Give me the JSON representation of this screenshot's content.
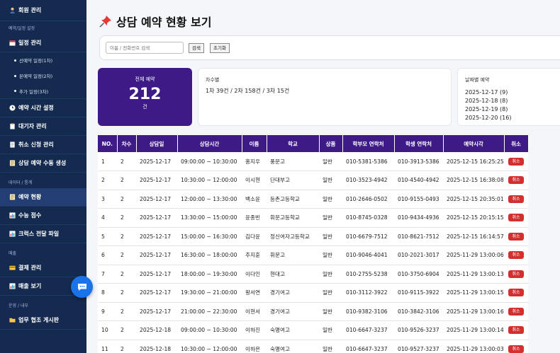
{
  "sidebar": {
    "member": "회원 관리",
    "section1": "예약/일정 설정",
    "schedule": "일정 관리",
    "sub1": "선예약 일정(1차)",
    "sub2": "본예약 일정(2차)",
    "sub3": "추가 일정(3차)",
    "time": "예약 시간 설정",
    "waiting": "대기자 관리",
    "cancel": "취소 신청 관리",
    "manual": "상담 예약 수동 생성",
    "section2": "데이터 / 통계",
    "status": "예약 현황",
    "score": "수능 점수",
    "file": "크럭스 전달 파일",
    "section3": "매출",
    "payment": "결제 관리",
    "sales": "매출 보기",
    "section4": "운영 / 내부",
    "board": "업무 협조 게시판"
  },
  "title": "상담 예약 현황 보기",
  "search": {
    "placeholder": "이름 / 전화번호 검색",
    "btn_search": "검색",
    "btn_reset": "초기화"
  },
  "summary": {
    "total_label": "전체 예약",
    "total_value": "212",
    "total_unit": "건",
    "round_label": "차수별",
    "round_value": "1차 39건 / 2차 158건 / 3차 15건",
    "date_label": "날짜별 예약",
    "dates": [
      "2025-12-17 (9)",
      "2025-12-18 (8)",
      "2025-12-19 (8)",
      "2025-12-20 (16)"
    ]
  },
  "table": {
    "headers": [
      "NO.",
      "차수",
      "상담일",
      "상담시간",
      "이름",
      "학교",
      "상품",
      "학부모 연락처",
      "학생 연락처",
      "예약시각",
      "취소"
    ],
    "cancel_label": "취소",
    "rows": [
      [
        "1",
        "2",
        "2025-12-17",
        "09:00:00 ~ 10:30:00",
        "홍지우",
        "풍문고",
        "일반",
        "010-5381-5386",
        "010-3913-5386",
        "2025-12-15 16:25:25"
      ],
      [
        "2",
        "2",
        "2025-12-17",
        "10:30:00 ~ 12:00:00",
        "이시현",
        "단대부고",
        "일반",
        "010-3523-4942",
        "010-4540-4942",
        "2025-12-15 16:38:08"
      ],
      [
        "3",
        "2",
        "2025-12-17",
        "12:00:00 ~ 13:30:00",
        "백소윤",
        "등촌고등학교",
        "일반",
        "010-2646-0502",
        "010-9155-0493",
        "2025-12-15 20:35:01"
      ],
      [
        "4",
        "2",
        "2025-12-17",
        "13:30:00 ~ 15:00:00",
        "윤종빈",
        "휘문고등학교",
        "일반",
        "010-8745-0328",
        "010-9434-4936",
        "2025-12-15 20:15:15"
      ],
      [
        "5",
        "2",
        "2025-12-17",
        "15:00:00 ~ 16:30:00",
        "김다윤",
        "정신여자고등학교",
        "일반",
        "010-6679-7512",
        "010-8621-7512",
        "2025-12-15 16:14:57"
      ],
      [
        "6",
        "2",
        "2025-12-17",
        "16:30:00 ~ 18:00:00",
        "추지훈",
        "휘문고",
        "일반",
        "010-9046-4041",
        "010-2021-3017",
        "2025-11-29 13:00:06"
      ],
      [
        "7",
        "2",
        "2025-12-17",
        "18:00:00 ~ 19:30:00",
        "이다인",
        "현대고",
        "일반",
        "010-2755-5238",
        "010-3750-6904",
        "2025-11-29 13:00:13"
      ],
      [
        "8",
        "2",
        "2025-12-17",
        "19:30:00 ~ 21:00:00",
        "왕서연",
        "경기여고",
        "일반",
        "010-3112-3922",
        "010-9115-3922",
        "2025-11-29 13:00:15"
      ],
      [
        "9",
        "2",
        "2025-12-17",
        "21:00:00 ~ 22:30:00",
        "이현서",
        "경기여고",
        "일반",
        "010-9382-3106",
        "010-3842-3106",
        "2025-11-29 13:00:16"
      ],
      [
        "10",
        "2",
        "2025-12-18",
        "09:00:00 ~ 10:30:00",
        "이하진",
        "숙명여고",
        "일반",
        "010-6647-3237",
        "010-9526-3237",
        "2025-11-29 13:00:14"
      ],
      [
        "11",
        "2",
        "2025-12-18",
        "10:30:00 ~ 12:00:00",
        "이하은",
        "숙명여고",
        "일반",
        "010-6647-3237",
        "010-9527-3237",
        "2025-11-29 13:00:03"
      ]
    ]
  },
  "colors": {
    "sidebar": "#142a4f",
    "accent": "#3d1a86",
    "danger": "#d32f2f",
    "fab": "#1a73e8"
  }
}
